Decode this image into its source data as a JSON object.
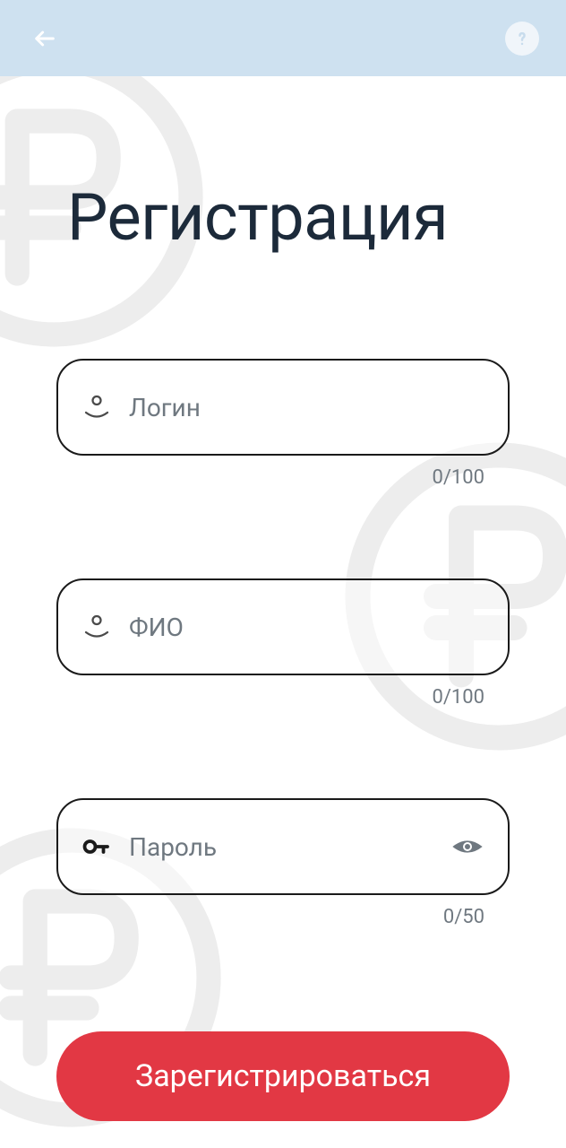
{
  "page": {
    "title": "Регистрация"
  },
  "fields": {
    "login": {
      "placeholder": "Логин",
      "counter": "0/100"
    },
    "fullname": {
      "placeholder": "ФИО",
      "counter": "0/100"
    },
    "password": {
      "placeholder": "Пароль",
      "counter": "0/50"
    }
  },
  "buttons": {
    "submit": "Зарегистрироваться"
  }
}
